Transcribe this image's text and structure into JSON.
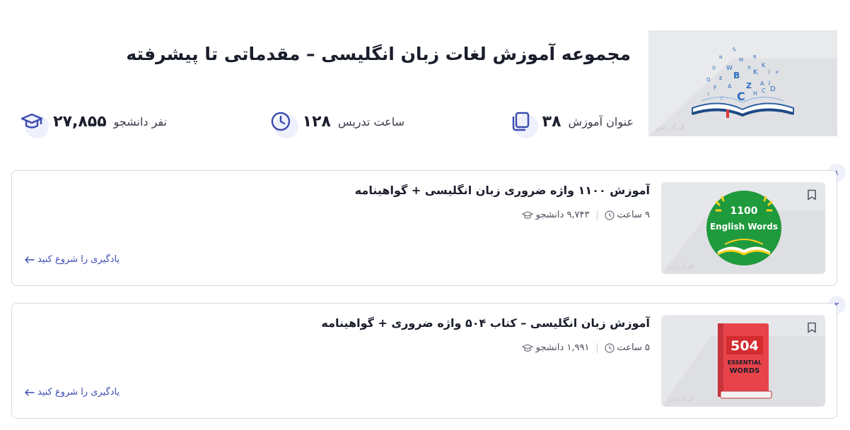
{
  "header": {
    "title": "مجموعه آموزش لغات زبان انگلیسی – مقدماتی تا پیشرفته",
    "stats": {
      "titles": {
        "value": "۳۸",
        "label": "عنوان آموزش"
      },
      "hours": {
        "value": "۱۲۸",
        "label": "ساعت تدریس"
      },
      "students": {
        "value": "۲۷,۸۵۵",
        "label": "نفر دانشجو"
      }
    },
    "watermark": "فرادرس"
  },
  "courses": [
    {
      "index": "۱",
      "title": "آموزش ۱۱۰۰ واژه ضروری زبان انگلیسی + گواهینامه",
      "students": "۹,۷۴۳ دانشجو",
      "hours": "۹ ساعت",
      "start_label": "یادگیری را شروع کنید",
      "thumb_line1": "1100",
      "thumb_line2": "English Words"
    },
    {
      "index": "۲",
      "title": "آموزش زبان انگلیسی – کتاب ۵۰۴ واژه ضروری + گواهینامه",
      "students": "۱,۹۹۱ دانشجو",
      "hours": "۵ ساعت",
      "start_label": "یادگیری را شروع کنید",
      "thumb_line1": "504",
      "thumb_line2": "ESSENTIAL",
      "thumb_line3": "WORDS"
    }
  ],
  "colors": {
    "accent": "#3b4bb0",
    "green": "#1e9a3c",
    "red": "#e8434a"
  }
}
